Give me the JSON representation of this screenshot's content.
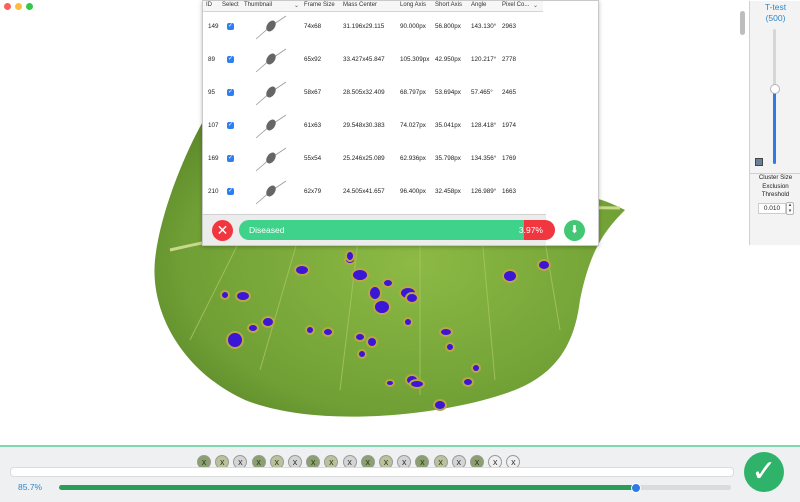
{
  "window": {
    "traffic_lights": [
      {
        "name": "close",
        "color": "#fc605b"
      },
      {
        "name": "minimize",
        "color": "#fdbc40"
      },
      {
        "name": "maximize",
        "color": "#34c84a"
      }
    ]
  },
  "zoom": {
    "in_label": "+",
    "out_label": "−"
  },
  "table": {
    "headers": [
      "ID",
      "Select",
      "Thumbnail",
      "Frame Size",
      "Mass Center",
      "Long Axis",
      "Short Axis",
      "Angle",
      "Pixel Co..."
    ],
    "rows": [
      {
        "id": "149",
        "frame": "74x68",
        "mass": "31.196x29.115",
        "long": "90.000px",
        "short": "56.800px",
        "angle": "143.130°",
        "pixels": "2963"
      },
      {
        "id": "89",
        "frame": "65x92",
        "mass": "33.427x45.847",
        "long": "105.309px",
        "short": "42.950px",
        "angle": "120.217°",
        "pixels": "2778"
      },
      {
        "id": "95",
        "frame": "58x67",
        "mass": "28.505x32.409",
        "long": "68.797px",
        "short": "53.694px",
        "angle": "57.465°",
        "pixels": "2465"
      },
      {
        "id": "107",
        "frame": "61x63",
        "mass": "29.548x30.383",
        "long": "74.027px",
        "short": "35.041px",
        "angle": "128.418°",
        "pixels": "1974"
      },
      {
        "id": "169",
        "frame": "55x54",
        "mass": "25.246x25.089",
        "long": "62.936px",
        "short": "35.798px",
        "angle": "134.356°",
        "pixels": "1769"
      },
      {
        "id": "210",
        "frame": "62x79",
        "mass": "24.505x41.657",
        "long": "96.400px",
        "short": "32.458px",
        "angle": "126.989°",
        "pixels": "1663"
      }
    ]
  },
  "side": {
    "ttest_label": "T-test",
    "ttest_value": "(500)",
    "ttest_level": 0.55,
    "cluster_label_1": "Cluster Size",
    "cluster_label_2": "Exclusion",
    "cluster_label_3": "Threshold",
    "cluster_value": "0.010"
  },
  "status": {
    "label": "Diseased",
    "percent_text": "3.97%",
    "percent": 0.0397,
    "bar_color": "#3ed28a"
  },
  "bottom": {
    "progress_text": "85.7%",
    "progress": 0.857,
    "accent": "#2a9d5a",
    "chips": [
      "x",
      "x",
      "x",
      "x",
      "x",
      "x",
      "x",
      "x",
      "x",
      "x",
      "x",
      "x",
      "x",
      "x",
      "x",
      "x",
      "x",
      "x"
    ]
  }
}
